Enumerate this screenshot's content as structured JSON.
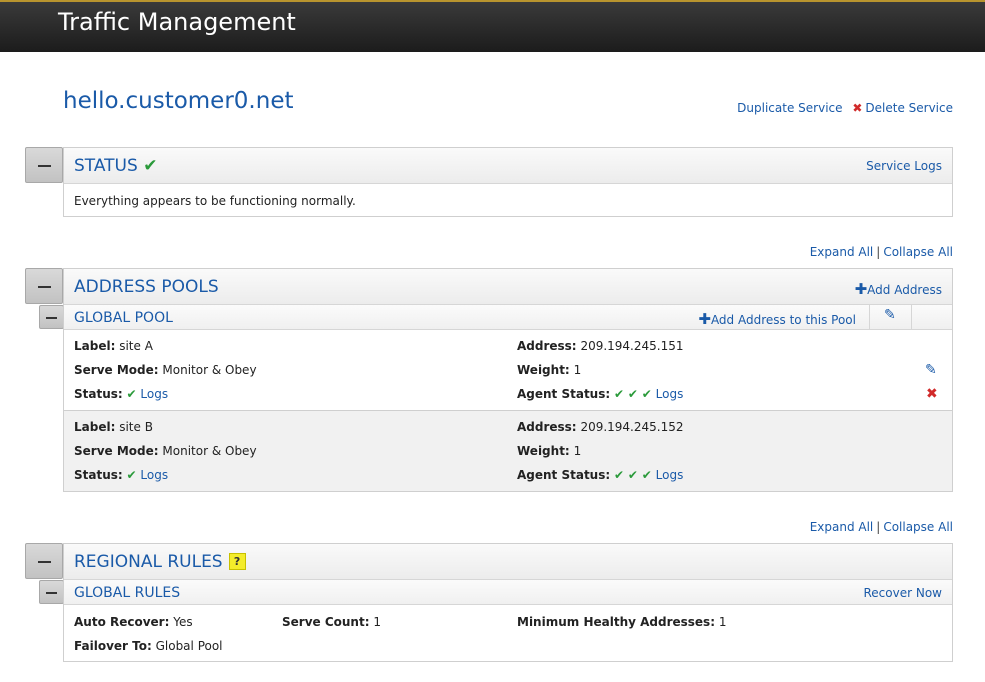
{
  "header": {
    "title": "Traffic Management"
  },
  "service": {
    "name": "hello.customer0.net",
    "duplicate": "Duplicate Service",
    "delete": "Delete Service"
  },
  "status": {
    "title": "STATUS",
    "logs": "Service Logs",
    "message": "Everything appears to be functioning normally."
  },
  "expand": {
    "expand_all": "Expand All",
    "sep": "|",
    "collapse_all": "Collapse All"
  },
  "pools": {
    "title": "ADDRESS POOLS",
    "add_address": "Add Address",
    "pool": {
      "title": "GLOBAL POOL",
      "add_to_pool": "Add Address to this Pool"
    },
    "labels": {
      "label": "Label:",
      "serve_mode": "Serve Mode:",
      "status": "Status:",
      "address": "Address:",
      "weight": "Weight:",
      "agent_status": "Agent Status:",
      "logs": "Logs"
    },
    "entries": [
      {
        "label": "site A",
        "serve_mode": "Monitor & Obey",
        "address": "209.194.245.151",
        "weight": "1"
      },
      {
        "label": "site B",
        "serve_mode": "Monitor & Obey",
        "address": "209.194.245.152",
        "weight": "1"
      }
    ]
  },
  "rules": {
    "title": "REGIONAL RULES",
    "help": "?",
    "global": {
      "title": "GLOBAL RULES",
      "recover": "Recover Now",
      "auto_recover_label": "Auto Recover:",
      "auto_recover": "Yes",
      "serve_count_label": "Serve Count:",
      "serve_count": "1",
      "min_healthy_label": "Minimum Healthy Addresses:",
      "min_healthy": "1",
      "failover_label": "Failover To:",
      "failover": "Global Pool"
    }
  },
  "glyphs": {
    "check": "✔",
    "plus": "✚",
    "pencil": "✎",
    "x": "✖"
  },
  "colors": {
    "link": "#1a5aa8",
    "ok": "#2a9a3a",
    "error": "#d12a2a",
    "help": "#f4ec2a"
  }
}
